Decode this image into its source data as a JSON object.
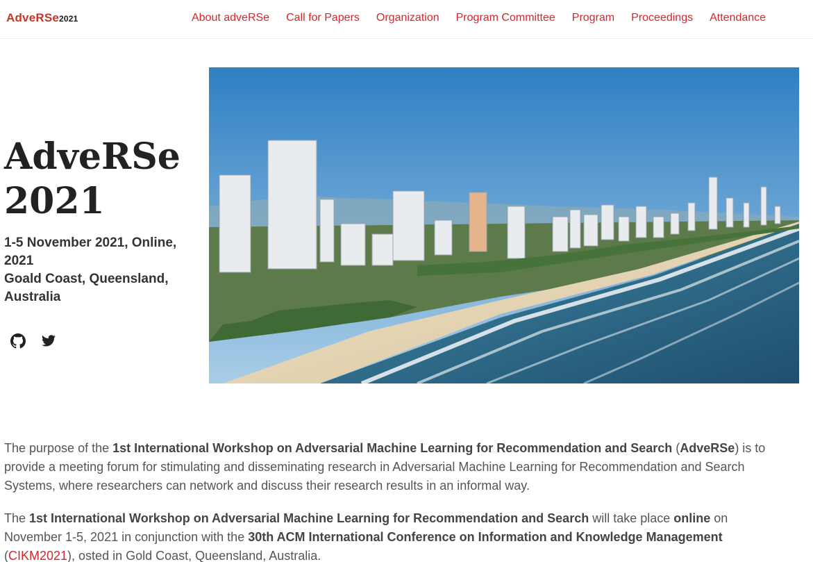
{
  "brand": {
    "name": "AdveRSe",
    "year": "2021"
  },
  "nav": {
    "items": [
      {
        "label": "About adveRSe"
      },
      {
        "label": "Call for Papers"
      },
      {
        "label": "Organization"
      },
      {
        "label": "Program Committee"
      },
      {
        "label": "Program"
      },
      {
        "label": "Proceedings"
      },
      {
        "label": "Attendance"
      }
    ]
  },
  "hero": {
    "title_line1": "AdveRSe",
    "title_line2": "2021",
    "date_line": "1-5 November 2021, Online, 2021",
    "location_line": "Goald Coast, Queensland, Australia",
    "social_icons": [
      "github-icon",
      "twitter-icon"
    ]
  },
  "colors": {
    "accent": "#d0282c",
    "brand": "#c0392b",
    "sky": "#4a90c8",
    "sea": "#2e6f8e",
    "sand": "#e8d9b8"
  },
  "content": {
    "p1": {
      "t1": "The purpose of the ",
      "b1": "1st International Workshop on Adversarial Machine Learning for Recommendation and Search",
      "t2": " (",
      "b2": "AdveRSe",
      "t3": ") is to provide a meeting forum for stimulating and disseminating research in Adversarial Machine Learning for Recommendation and Search Systems, where researchers can network and discuss their research results in an informal way."
    },
    "p2": {
      "t1": "The ",
      "b1": "1st International Workshop on Adversarial Machine Learning for Recommendation and Search",
      "t2": " will take place ",
      "b2": "online",
      "t3": " on November 1-5, 2021 in conjunction with the ",
      "b3": "30th ACM International Conference on Information and Knowledge Management",
      "t4": " (",
      "link": "CIKM2021",
      "t5": "), osted in Gold Coast, Queensland, Australia."
    }
  }
}
